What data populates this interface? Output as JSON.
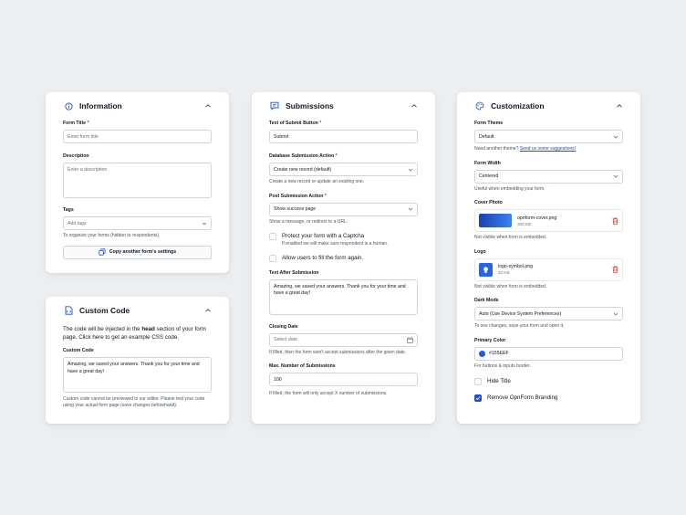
{
  "information": {
    "title": "Information",
    "form_title_label": "Form Title",
    "form_title_placeholder": "Enter form title",
    "description_label": "Description",
    "description_placeholder": "Enter a description",
    "tags_label": "Tags",
    "tags_placeholder": "Add tags",
    "tags_help": "To organize your forms (hidden to respondents).",
    "copy_button": "Copy another form's settings"
  },
  "custom_code": {
    "title": "Custom Code",
    "intro_1": "The code will be injected in the ",
    "intro_bold": "head",
    "intro_2": " section of your form page. Click here to get an example CSS code.",
    "label": "Custom Code",
    "value": "Amazing, we saved your answers. Thank you for your time and have a great day!",
    "help": "Custom code cannot be previewed in our editor. Please test your code using your actual form page (save changes beforehand)."
  },
  "submissions": {
    "title": "Submissions",
    "submit_text_label": "Text of Submit Button",
    "submit_text_value": "Submit",
    "db_action_label": "Database Submission Action",
    "db_action_value": "Create new record (default)",
    "db_action_help": "Create a new record or update an existing one.",
    "post_action_label": "Post Submission Action",
    "post_action_value": "Show success page",
    "post_action_help": "Show a message, or redirect to a URL.",
    "captcha_label": "Protect your form with a Captcha",
    "captcha_help": "If enabled we will make sure respondent is a human.",
    "allow_refill_label": "Allow users to fill the form again.",
    "text_after_label": "Text After Submission",
    "text_after_value": "Amazing, we saved your answers. Thank you for your time and have a great day!",
    "closing_date_label": "Closing Date",
    "closing_date_placeholder": "Select date",
    "closing_date_help": "If filled, then the form won't accept submissions after the given date.",
    "max_label": "Max. Number of Submissions",
    "max_value": "100",
    "max_help": "If filled, the form will only accept X number of submissions."
  },
  "customization": {
    "title": "Customization",
    "theme_label": "Form Theme",
    "theme_value": "Default",
    "theme_help_prefix": "Need another theme? ",
    "theme_help_link": "Send us some suggestions!",
    "width_label": "Form Width",
    "width_value": "Centered",
    "width_help": "Useful when embedding your form.",
    "cover_label": "Cover Photo",
    "cover_name": "opnform-cover.png",
    "cover_size": "200 KB",
    "cover_help": "Not visible when form is embedded.",
    "logo_label": "Logo",
    "logo_name": "logo-symbol.png",
    "logo_size": "32 KB",
    "logo_help": "Not visible when form is embedded.",
    "dark_label": "Dark Mode",
    "dark_value": "Auto (Use Device System Preferences)",
    "dark_help": "To see changes, save your form and open it.",
    "color_label": "Primary Color",
    "color_value": "#155EEF",
    "color_help": "For buttons & inputs border.",
    "hide_title_label": "Hide Title",
    "remove_branding_label": "Remove OpnForm Branding"
  },
  "colors": {
    "accent": "#1d4ed8",
    "primary": "#155EEF",
    "danger": "#e02424"
  }
}
